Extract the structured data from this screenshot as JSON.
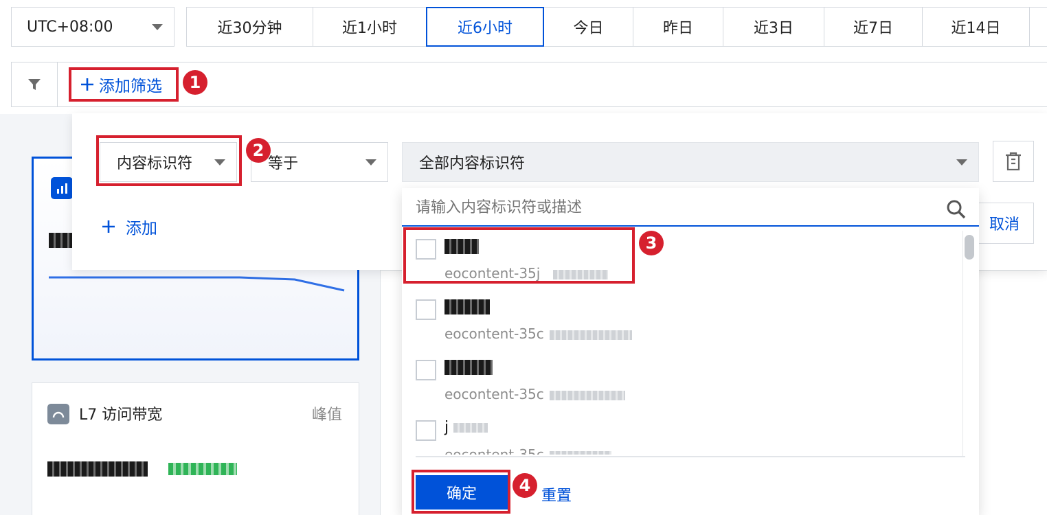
{
  "timezone": {
    "value": "UTC+08:00"
  },
  "time_ranges": [
    {
      "label": "近30分钟",
      "active": false
    },
    {
      "label": "近1小时",
      "active": false
    },
    {
      "label": "近6小时",
      "active": true
    },
    {
      "label": "今日",
      "active": false
    },
    {
      "label": "昨日",
      "active": false
    },
    {
      "label": "近3日",
      "active": false
    },
    {
      "label": "近7日",
      "active": false
    },
    {
      "label": "近14日",
      "active": false
    }
  ],
  "filter_bar": {
    "add_filter_label": "添加筛选"
  },
  "filter_panel": {
    "field_select": "内容标识符",
    "operator_select": "等于",
    "value_select": "全部内容标识符",
    "add_label": "添加",
    "cancel_label": "取消"
  },
  "dropdown": {
    "search_placeholder": "请输入内容标识符或描述",
    "items": [
      {
        "desc_prefix": "eocontent-35j",
        "checked": false
      },
      {
        "desc_prefix": "eocontent-35c",
        "checked": false
      },
      {
        "desc_prefix": "eocontent-35c",
        "checked": false
      },
      {
        "name_prefix": "j",
        "desc_prefix": "eocontent-35c",
        "checked": false
      }
    ],
    "confirm_label": "确定",
    "reset_label": "重置"
  },
  "cards": {
    "bandwidth": {
      "title": "L7 访问带宽",
      "tag": "峰值"
    }
  },
  "annotations": [
    "1",
    "2",
    "3",
    "4"
  ],
  "colors": {
    "accent": "#0052d9",
    "annotation_red": "#d6202e",
    "positive": "#2fb457"
  }
}
